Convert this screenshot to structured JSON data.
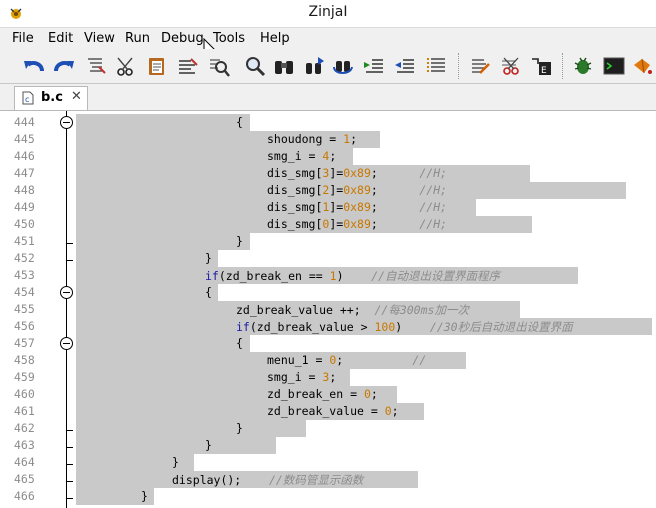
{
  "window": {
    "title": "ZinjaI"
  },
  "menu": [
    "File",
    "Edit",
    "View",
    "Run",
    "Debug",
    "Tools",
    "Help"
  ],
  "toolbar_icons": [
    "undo-icon",
    "redo-icon",
    "format-icon",
    "cut-icon",
    "paste-icon",
    "comment-icon",
    "find-icon",
    "find-file-icon",
    "binoculars-icon",
    "find-prev-icon",
    "find-next-icon",
    "indent-icon",
    "outdent-icon",
    "list-icon",
    "wand-icon",
    "scissors-icon",
    "run-console-icon",
    "debug-bug-icon",
    "terminal-icon",
    "paint-icon"
  ],
  "tab": {
    "label": "b.c",
    "close": "✕"
  },
  "lines": [
    {
      "n": "444",
      "fold": "open",
      "sel": [
        76,
        250
      ],
      "tokens": [
        {
          "t": "{",
          "c": ""
        }
      ],
      "indent": 236
    },
    {
      "n": "445",
      "fold": "",
      "sel": [
        76,
        380
      ],
      "tokens": [
        {
          "t": "shoudong = ",
          "c": ""
        },
        {
          "t": "1",
          "c": "num"
        },
        {
          "t": ";",
          "c": ""
        }
      ],
      "indent": 267
    },
    {
      "n": "446",
      "fold": "",
      "sel": [
        76,
        353
      ],
      "tokens": [
        {
          "t": "smg_i = ",
          "c": ""
        },
        {
          "t": "4",
          "c": "num"
        },
        {
          "t": ";",
          "c": ""
        }
      ],
      "indent": 267
    },
    {
      "n": "447",
      "fold": "",
      "sel": [
        76,
        530
      ],
      "tokens": [
        {
          "t": "dis_smg[",
          "c": ""
        },
        {
          "t": "3",
          "c": "num"
        },
        {
          "t": "]=",
          "c": ""
        },
        {
          "t": "0x89",
          "c": "num"
        },
        {
          "t": ";      ",
          "c": ""
        },
        {
          "t": "//H;",
          "c": "cm"
        }
      ],
      "indent": 267
    },
    {
      "n": "448",
      "fold": "",
      "sel": [
        76,
        626
      ],
      "tokens": [
        {
          "t": "dis_smg[",
          "c": ""
        },
        {
          "t": "2",
          "c": "num"
        },
        {
          "t": "]=",
          "c": ""
        },
        {
          "t": "0x89",
          "c": "num"
        },
        {
          "t": ";      ",
          "c": ""
        },
        {
          "t": "//H;",
          "c": "cm"
        }
      ],
      "indent": 267
    },
    {
      "n": "449",
      "fold": "",
      "sel": [
        76,
        476
      ],
      "tokens": [
        {
          "t": "dis_smg[",
          "c": ""
        },
        {
          "t": "1",
          "c": "num"
        },
        {
          "t": "]=",
          "c": ""
        },
        {
          "t": "0x89",
          "c": "num"
        },
        {
          "t": ";      ",
          "c": ""
        },
        {
          "t": "//H;",
          "c": "cm"
        }
      ],
      "indent": 267
    },
    {
      "n": "450",
      "fold": "",
      "sel": [
        76,
        532
      ],
      "tokens": [
        {
          "t": "dis_smg[",
          "c": ""
        },
        {
          "t": "0",
          "c": "num"
        },
        {
          "t": "]=",
          "c": ""
        },
        {
          "t": "0x89",
          "c": "num"
        },
        {
          "t": ";      ",
          "c": ""
        },
        {
          "t": "//H;",
          "c": "cm"
        }
      ],
      "indent": 267
    },
    {
      "n": "451",
      "fold": "end",
      "sel": [
        76,
        250
      ],
      "tokens": [
        {
          "t": "}",
          "c": ""
        }
      ],
      "indent": 236
    },
    {
      "n": "452",
      "fold": "end",
      "sel": [
        76,
        218
      ],
      "tokens": [
        {
          "t": "}",
          "c": ""
        }
      ],
      "indent": 205
    },
    {
      "n": "453",
      "fold": "",
      "sel": [
        76,
        578
      ],
      "tokens": [
        {
          "t": "if",
          "c": "kw"
        },
        {
          "t": "(zd_break_en == ",
          "c": ""
        },
        {
          "t": "1",
          "c": "num"
        },
        {
          "t": ")    ",
          "c": ""
        },
        {
          "t": "//自动退出设置界面程序",
          "c": "cm"
        }
      ],
      "indent": 205
    },
    {
      "n": "454",
      "fold": "open",
      "sel": [
        76,
        218
      ],
      "tokens": [
        {
          "t": "{",
          "c": ""
        }
      ],
      "indent": 205
    },
    {
      "n": "455",
      "fold": "",
      "sel": [
        76,
        520
      ],
      "tokens": [
        {
          "t": "zd_break_value ++;  ",
          "c": ""
        },
        {
          "t": "//每300ms加一次",
          "c": "cm"
        }
      ],
      "indent": 236
    },
    {
      "n": "456",
      "fold": "",
      "sel": [
        76,
        652
      ],
      "tokens": [
        {
          "t": "if",
          "c": "kw"
        },
        {
          "t": "(zd_break_value > ",
          "c": ""
        },
        {
          "t": "100",
          "c": "num"
        },
        {
          "t": ")    ",
          "c": ""
        },
        {
          "t": "//30秒后自动退出设置界面",
          "c": "cm"
        }
      ],
      "indent": 236
    },
    {
      "n": "457",
      "fold": "open",
      "sel": [
        76,
        250
      ],
      "tokens": [
        {
          "t": "{",
          "c": ""
        }
      ],
      "indent": 236
    },
    {
      "n": "458",
      "fold": "",
      "sel": [
        76,
        466
      ],
      "tokens": [
        {
          "t": "menu_1 = ",
          "c": ""
        },
        {
          "t": "0",
          "c": "num"
        },
        {
          "t": ";          ",
          "c": ""
        },
        {
          "t": "//",
          "c": "cm"
        }
      ],
      "indent": 267
    },
    {
      "n": "459",
      "fold": "",
      "sel": [
        76,
        350
      ],
      "tokens": [
        {
          "t": "smg_i = ",
          "c": ""
        },
        {
          "t": "3",
          "c": "num"
        },
        {
          "t": ";",
          "c": ""
        }
      ],
      "indent": 267
    },
    {
      "n": "460",
      "fold": "",
      "sel": [
        76,
        397
      ],
      "tokens": [
        {
          "t": "zd_break_en = ",
          "c": ""
        },
        {
          "t": "0",
          "c": "num"
        },
        {
          "t": ";",
          "c": ""
        }
      ],
      "indent": 267
    },
    {
      "n": "461",
      "fold": "",
      "sel": [
        76,
        424
      ],
      "tokens": [
        {
          "t": "zd_break_value = ",
          "c": ""
        },
        {
          "t": "0",
          "c": "num"
        },
        {
          "t": ";",
          "c": ""
        }
      ],
      "indent": 267
    },
    {
      "n": "462",
      "fold": "end",
      "sel": [
        76,
        306
      ],
      "tokens": [
        {
          "t": "}",
          "c": ""
        }
      ],
      "indent": 236
    },
    {
      "n": "463",
      "fold": "end",
      "sel": [
        76,
        276
      ],
      "tokens": [
        {
          "t": "}",
          "c": ""
        }
      ],
      "indent": 205
    },
    {
      "n": "464",
      "fold": "end",
      "sel": [
        76,
        194
      ],
      "tokens": [
        {
          "t": "}",
          "c": ""
        }
      ],
      "indent": 172
    },
    {
      "n": "465",
      "fold": "end",
      "sel": [
        76,
        418
      ],
      "tokens": [
        {
          "t": "display();    ",
          "c": ""
        },
        {
          "t": "//数码管显示函数",
          "c": "cm"
        }
      ],
      "indent": 172
    },
    {
      "n": "466",
      "fold": "end",
      "sel": [
        76,
        154
      ],
      "tokens": [
        {
          "t": "}",
          "c": ""
        }
      ],
      "indent": 141
    }
  ]
}
